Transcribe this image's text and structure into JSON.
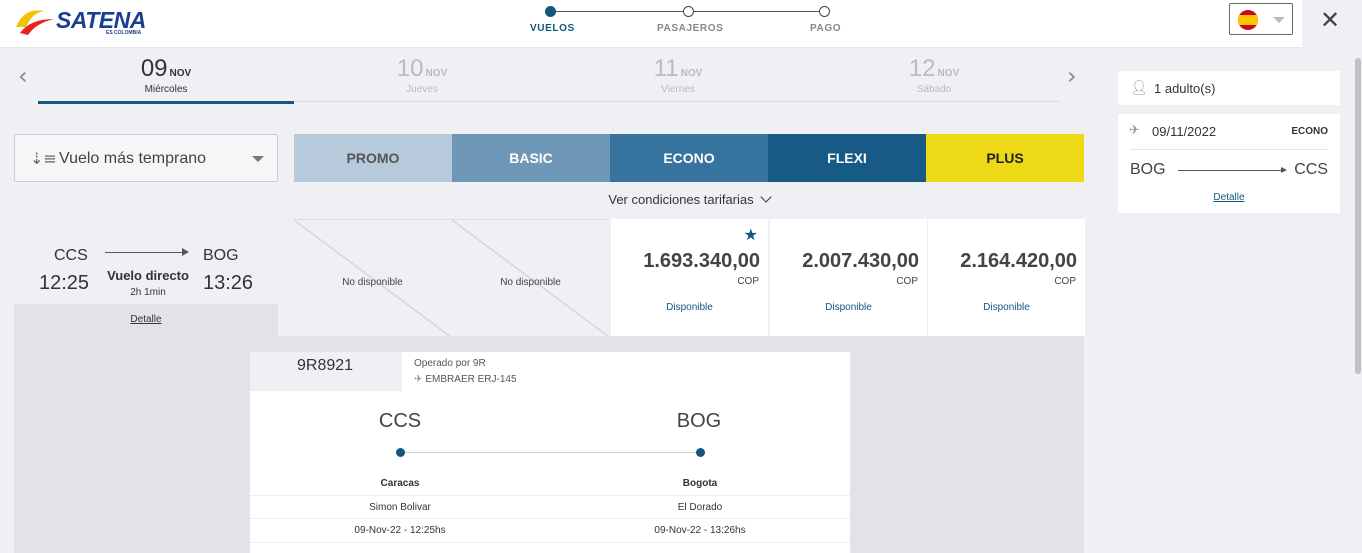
{
  "brand": {
    "name": "SATENA",
    "tagline": "ES COLOMBIA",
    "colors": {
      "primary": "#1a3f8f",
      "accent": "#14577d",
      "yellow": "#f2c300"
    }
  },
  "steps": [
    {
      "label": "VUELOS",
      "active": true
    },
    {
      "label": "PASAJEROS",
      "active": false
    },
    {
      "label": "PAGO",
      "active": false
    }
  ],
  "language": {
    "flag": "spain-flag-icon"
  },
  "dates": [
    {
      "day": "09",
      "month": "NOV",
      "weekday": "Miércoles",
      "active": true
    },
    {
      "day": "10",
      "month": "NOV",
      "weekday": "Jueves",
      "active": false
    },
    {
      "day": "11",
      "month": "NOV",
      "weekday": "Viernes",
      "active": false
    },
    {
      "day": "12",
      "month": "NOV",
      "weekday": "Sábado",
      "active": false
    }
  ],
  "sort": {
    "label": "Vuelo más temprano"
  },
  "fares": [
    {
      "label": "PROMO",
      "bg": "#b7cadb",
      "color": "#555555"
    },
    {
      "label": "BASIC",
      "bg": "#6f98b8",
      "color": "#ffffff"
    },
    {
      "label": "ECONO",
      "bg": "#36739e",
      "color": "#ffffff"
    },
    {
      "label": "FLEXI",
      "bg": "#175a86",
      "color": "#ffffff"
    },
    {
      "label": "PLUS",
      "bg": "#eed916",
      "color": "#222222"
    }
  ],
  "conditions_label": "Ver condiciones tarifarias",
  "flight": {
    "origin": "CCS",
    "destination": "BOG",
    "departure": "12:25",
    "arrival": "13:26",
    "type": "Vuelo directo",
    "duration": "2h 1min",
    "detail_label": "Detalle"
  },
  "fare_cells": [
    {
      "status": "No disponible"
    },
    {
      "status": "No disponible"
    },
    {
      "price": "1.693.340,00",
      "currency": "COP",
      "status": "Disponible",
      "starred": true
    },
    {
      "price": "2.007.430,00",
      "currency": "COP",
      "status": "Disponible"
    },
    {
      "price": "2.164.420,00",
      "currency": "COP",
      "status": "Disponible"
    }
  ],
  "detail": {
    "flight_number": "9R8921",
    "operated_by": "Operado por 9R",
    "aircraft": "EMBRAER ERJ-145",
    "origin": {
      "code": "CCS",
      "city": "Caracas",
      "airport": "Simon Bolivar",
      "datetime": "09-Nov-22 - 12:25hs"
    },
    "destination": {
      "code": "BOG",
      "city": "Bogota",
      "airport": "El Dorado",
      "datetime": "09-Nov-22 - 13:26hs"
    }
  },
  "summary": {
    "passengers": "1 adulto(s)",
    "date": "09/11/2022",
    "class": "ECONO",
    "from": "BOG",
    "to": "CCS",
    "detail_label": "Detalle"
  }
}
